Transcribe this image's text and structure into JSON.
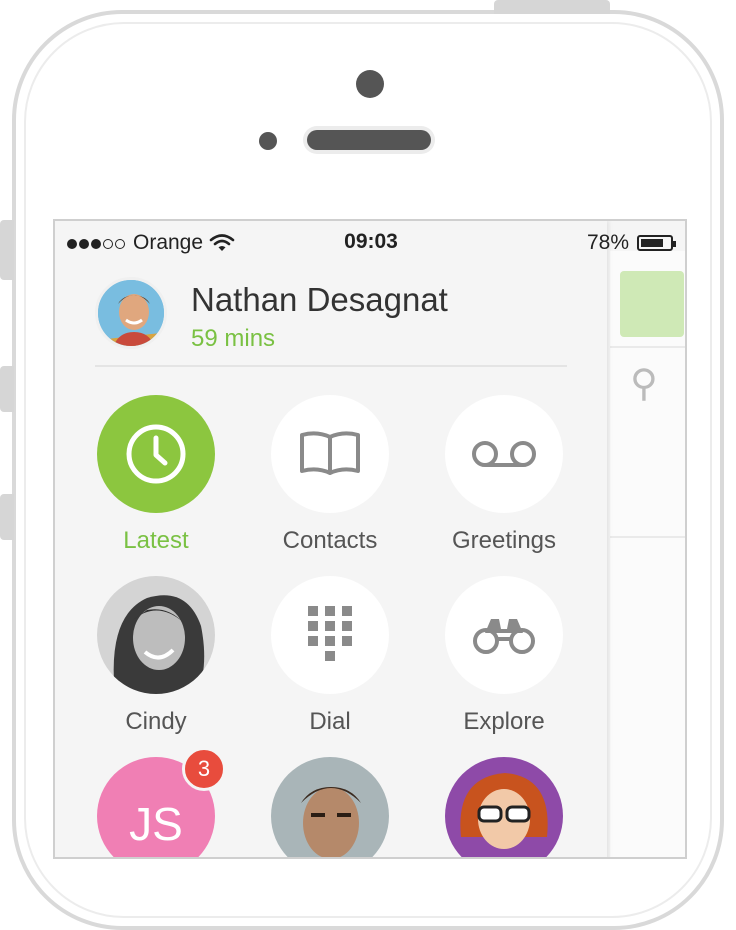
{
  "status_bar": {
    "carrier": "Orange",
    "time": "09:03",
    "battery": "78%",
    "battery_level": 0.78
  },
  "profile": {
    "name": "Nathan Desagnat",
    "minutes": "59 mins"
  },
  "menu": {
    "latest": "Latest",
    "contacts": "Contacts",
    "greetings": "Greetings",
    "dial": "Dial",
    "explore": "Explore"
  },
  "favorites": {
    "cindy": "Cindy",
    "js_initials": "JS",
    "js_badge": "3"
  },
  "colors": {
    "accent": "#8cc63f",
    "accent_text": "#7ac143",
    "badge": "#e84c3d",
    "js_avatar": "#f07fb4"
  }
}
